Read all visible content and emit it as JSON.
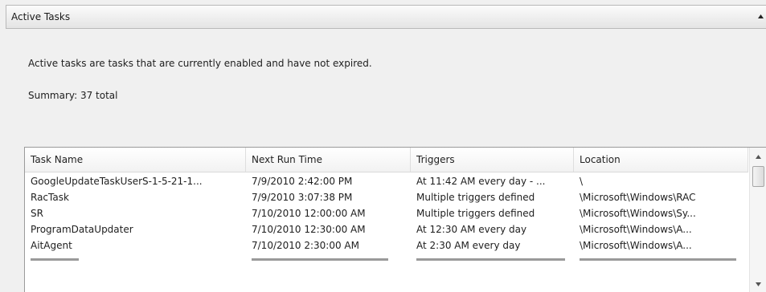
{
  "panel": {
    "title": "Active Tasks",
    "description": "Active tasks are tasks that are currently enabled and have not expired.",
    "summary": "Summary: 37 total"
  },
  "table": {
    "columns": [
      "Task Name",
      "Next Run Time",
      "Triggers",
      "Location"
    ],
    "rows": [
      {
        "name": "GoogleUpdateTaskUserS-1-5-21-1...",
        "next_run": "7/9/2010 2:42:00 PM",
        "triggers": "At 11:42 AM every day - ...",
        "location": "\\"
      },
      {
        "name": "RacTask",
        "next_run": "7/9/2010 3:07:38 PM",
        "triggers": "Multiple triggers defined",
        "location": "\\Microsoft\\Windows\\RAC"
      },
      {
        "name": "SR",
        "next_run": "7/10/2010 12:00:00 AM",
        "triggers": "Multiple triggers defined",
        "location": "\\Microsoft\\Windows\\Sy..."
      },
      {
        "name": "ProgramDataUpdater",
        "next_run": "7/10/2010 12:30:00 AM",
        "triggers": "At 12:30 AM every day",
        "location": "\\Microsoft\\Windows\\A..."
      },
      {
        "name": "AitAgent",
        "next_run": "7/10/2010 2:30:00 AM",
        "triggers": "At 2:30 AM every day",
        "location": "\\Microsoft\\Windows\\A..."
      }
    ]
  },
  "icons": {
    "collapse": "chevron-up-icon",
    "scroll_up": "scroll-up-arrow-icon",
    "scroll_down": "scroll-down-arrow-icon"
  }
}
